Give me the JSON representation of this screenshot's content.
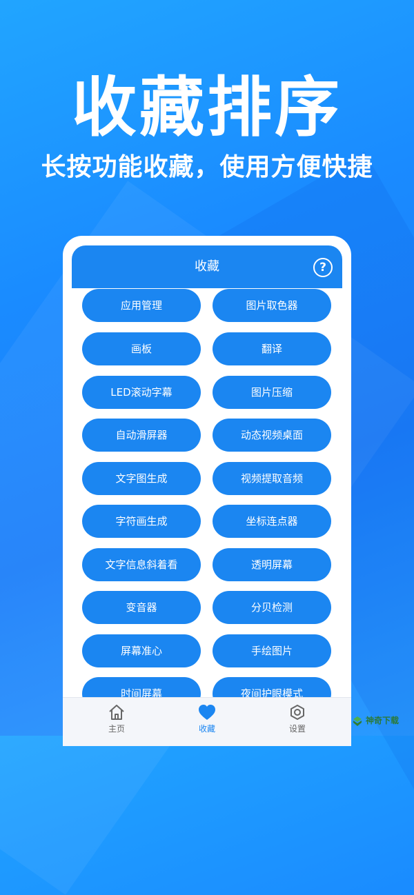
{
  "headline": "收藏排序",
  "subline": "长按功能收藏，使用方便快捷",
  "appbar": {
    "title": "收藏",
    "help_icon": "question-circle-icon"
  },
  "buttons": [
    "应用管理",
    "图片取色器",
    "画板",
    "翻译",
    "LED滚动字幕",
    "图片压缩",
    "自动滑屏器",
    "动态视频桌面",
    "文字图生成",
    "视频提取音频",
    "字符画生成",
    "坐标连点器",
    "文字信息斜着看",
    "透明屏幕",
    "变音器",
    "分贝检测",
    "屏幕准心",
    "手绘图片",
    "时间屏幕",
    "夜间护眼模式"
  ],
  "nav": [
    {
      "label": "主页",
      "icon": "home-icon",
      "active": false
    },
    {
      "label": "收藏",
      "icon": "heart-icon",
      "active": true
    },
    {
      "label": "设置",
      "icon": "settings-icon",
      "active": false
    }
  ],
  "watermark": "神奇下载",
  "colors": {
    "primary": "#1b86f1",
    "nav_active": "#1b86f1"
  }
}
